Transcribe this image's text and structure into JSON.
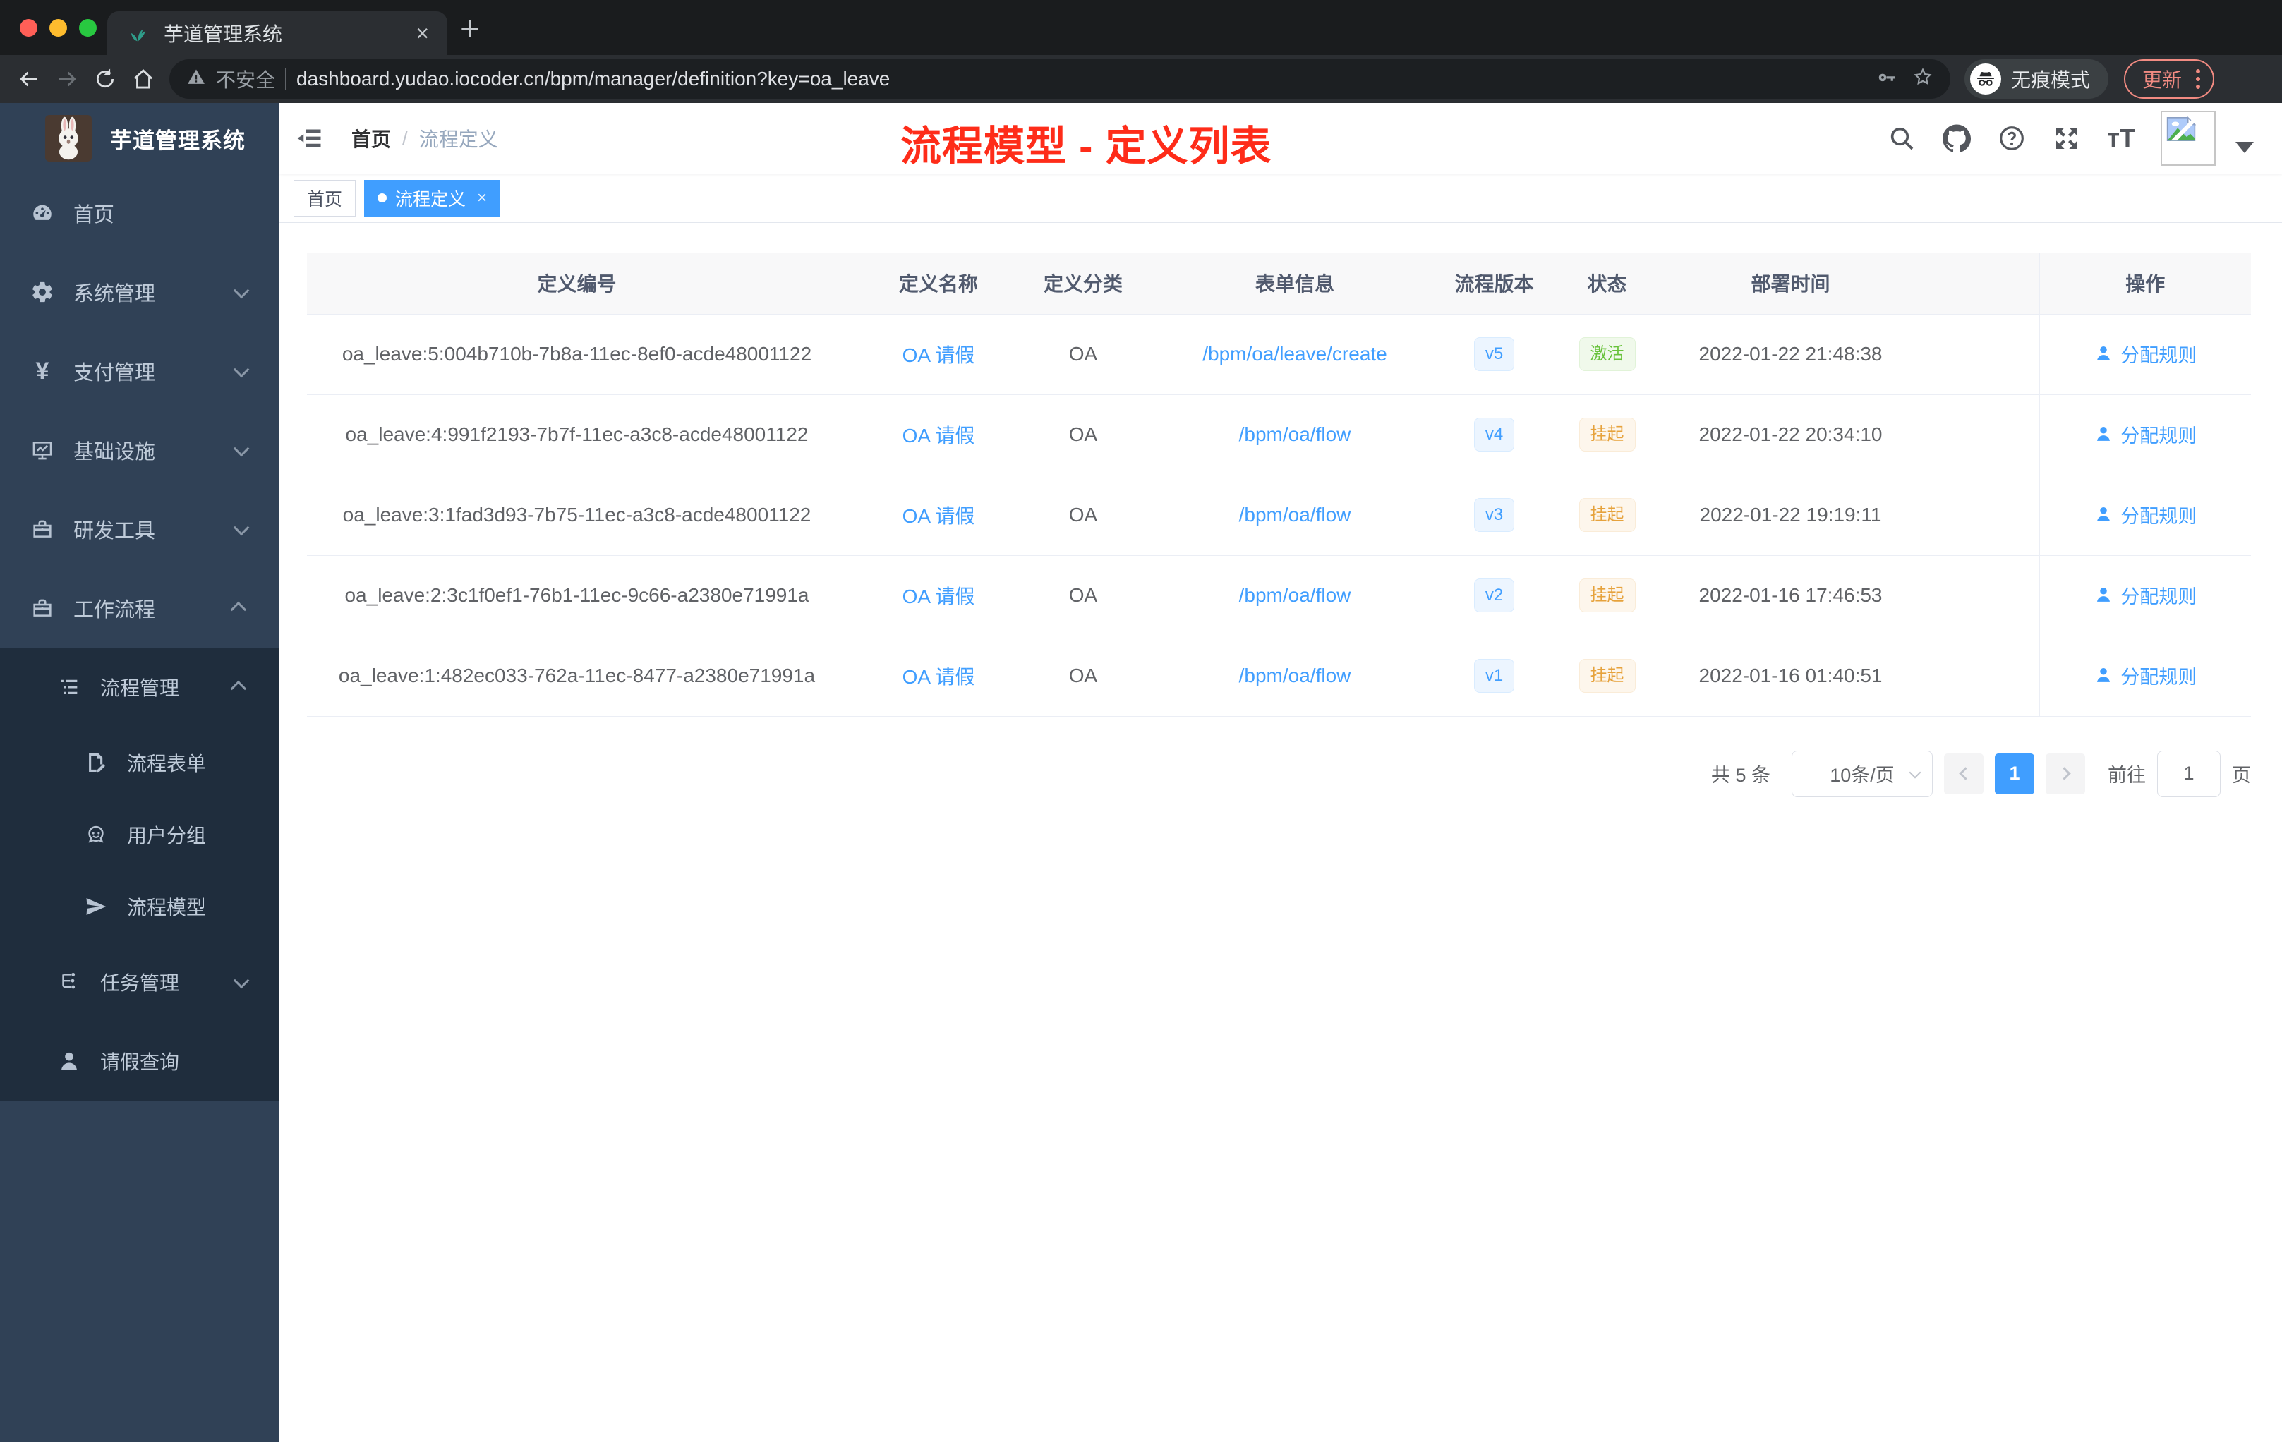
{
  "browser": {
    "tab": {
      "title": "芋道管理系统",
      "close": "×",
      "new_tab": "+"
    },
    "address": {
      "security": "不安全",
      "url": "dashboard.yudao.iocoder.cn/bpm/manager/definition?key=oa_leave"
    },
    "incognito_label": "无痕模式",
    "update_label": "更新"
  },
  "sidebar": {
    "logo_title": "芋道管理系统",
    "items": [
      {
        "icon": "dashboard-icon",
        "label": "首页",
        "level": 0
      },
      {
        "icon": "gear-icon",
        "label": "系统管理",
        "level": 0,
        "chevron": "down"
      },
      {
        "icon": "yen-icon",
        "label": "支付管理",
        "level": 0,
        "chevron": "down"
      },
      {
        "icon": "monitor-icon",
        "label": "基础设施",
        "level": 0,
        "chevron": "down"
      },
      {
        "icon": "toolbox-icon",
        "label": "研发工具",
        "level": 0,
        "chevron": "down"
      },
      {
        "icon": "briefcase-icon",
        "label": "工作流程",
        "level": 0,
        "chevron": "up"
      },
      {
        "icon": "list-tree-icon",
        "label": "流程管理",
        "level": 1,
        "chevron": "up",
        "dark": true
      },
      {
        "icon": "form-icon",
        "label": "流程表单",
        "level": 2,
        "dark": true
      },
      {
        "icon": "robot-icon",
        "label": "用户分组",
        "level": 2,
        "dark": true
      },
      {
        "icon": "paper-plane-icon",
        "label": "流程模型",
        "level": 2,
        "dark": true
      },
      {
        "icon": "flow-tree-icon",
        "label": "任务管理",
        "level": 1,
        "chevron": "down",
        "dark": true
      },
      {
        "icon": "user-icon",
        "label": "请假查询",
        "level": 1,
        "dark": true
      }
    ]
  },
  "header": {
    "breadcrumb": {
      "home": "首页",
      "separator": "/",
      "current": "流程定义"
    },
    "annotation": "流程模型 - 定义列表"
  },
  "tags": [
    {
      "label": "首页",
      "active": false
    },
    {
      "label": "流程定义",
      "active": true,
      "close": "×"
    }
  ],
  "table": {
    "columns": [
      "定义编号",
      "定义名称",
      "定义分类",
      "表单信息",
      "流程版本",
      "状态",
      "部署时间",
      "操作"
    ],
    "rows": [
      {
        "id": "oa_leave:5:004b710b-7b8a-11ec-8ef0-acde48001122",
        "name": "OA 请假",
        "category": "OA",
        "form": "/bpm/oa/leave/create",
        "version": "v5",
        "status": "激活",
        "status_type": "success",
        "deploy_time": "2022-01-22 21:48:38",
        "action": "分配规则"
      },
      {
        "id": "oa_leave:4:991f2193-7b7f-11ec-a3c8-acde48001122",
        "name": "OA 请假",
        "category": "OA",
        "form": "/bpm/oa/flow",
        "version": "v4",
        "status": "挂起",
        "status_type": "warning",
        "deploy_time": "2022-01-22 20:34:10",
        "action": "分配规则"
      },
      {
        "id": "oa_leave:3:1fad3d93-7b75-11ec-a3c8-acde48001122",
        "name": "OA 请假",
        "category": "OA",
        "form": "/bpm/oa/flow",
        "version": "v3",
        "status": "挂起",
        "status_type": "warning",
        "deploy_time": "2022-01-22 19:19:11",
        "action": "分配规则"
      },
      {
        "id": "oa_leave:2:3c1f0ef1-76b1-11ec-9c66-a2380e71991a",
        "name": "OA 请假",
        "category": "OA",
        "form": "/bpm/oa/flow",
        "version": "v2",
        "status": "挂起",
        "status_type": "warning",
        "deploy_time": "2022-01-16 17:46:53",
        "action": "分配规则"
      },
      {
        "id": "oa_leave:1:482ec033-762a-11ec-8477-a2380e71991a",
        "name": "OA 请假",
        "category": "OA",
        "form": "/bpm/oa/flow",
        "version": "v1",
        "status": "挂起",
        "status_type": "warning",
        "deploy_time": "2022-01-16 01:40:51",
        "action": "分配规则"
      }
    ]
  },
  "pagination": {
    "total": "共 5 条",
    "page_size": "10条/页",
    "current_page": "1",
    "goto_label": "前往",
    "goto_value": "1",
    "goto_unit": "页"
  },
  "colors": {
    "accent_blue": "#409eff",
    "tag_active_blue": "#409eff",
    "status_active_green": "#67c23a",
    "status_suspend_orange": "#e6a23c",
    "annotation_red": "#fe2c19",
    "sidebar_bg": "#304156",
    "sidebar_submenu_bg": "#1f2d3d",
    "update_pill_red": "#f28b82"
  }
}
